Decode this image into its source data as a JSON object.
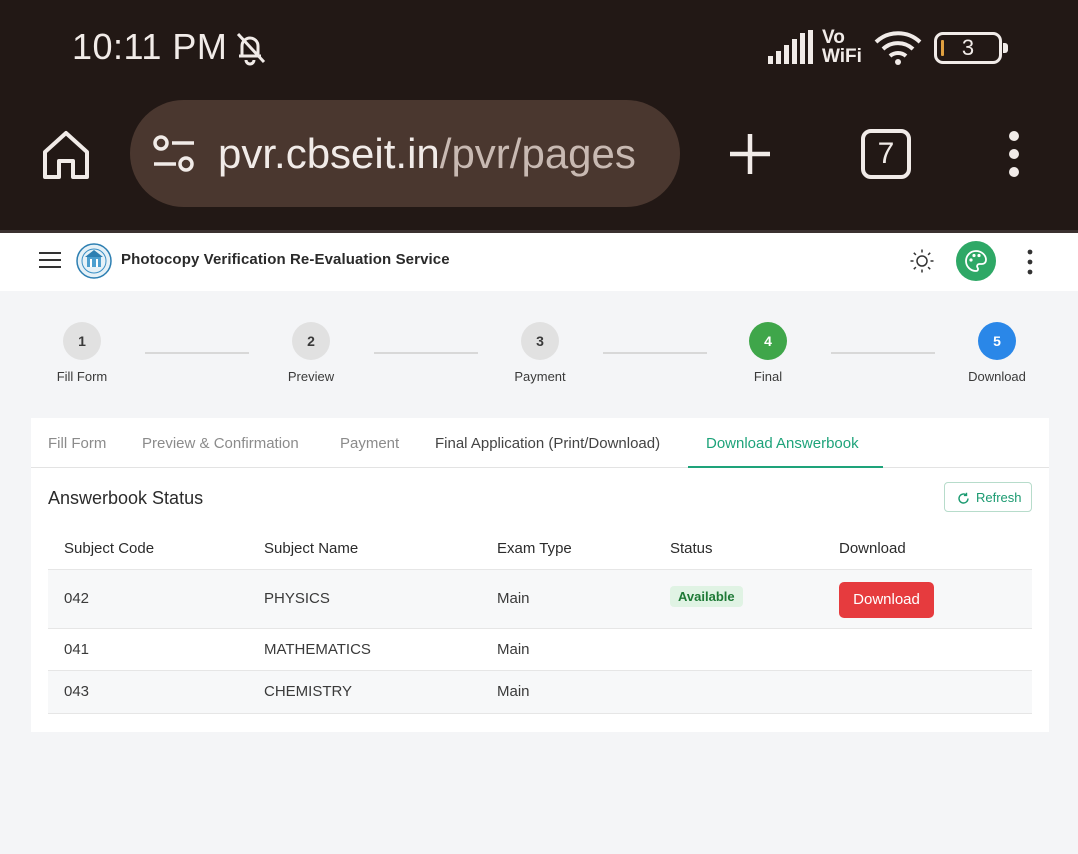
{
  "status_bar": {
    "time": "10:11 PM",
    "network": "Vo\nWiFi",
    "vo": "Vo",
    "wifi": "WiFi",
    "battery": "3"
  },
  "browser": {
    "url_host": "pvr.cbseit.in",
    "url_path": "/pvr/pages",
    "tab_count": "7"
  },
  "app": {
    "title": "Photocopy Verification Re-Evaluation Service",
    "accent": "#1ea37a"
  },
  "stepper": [
    {
      "number": "1",
      "label": "Fill Form",
      "state": "pending"
    },
    {
      "number": "2",
      "label": "Preview",
      "state": "pending"
    },
    {
      "number": "3",
      "label": "Payment",
      "state": "pending"
    },
    {
      "number": "4",
      "label": "Final",
      "state": "done"
    },
    {
      "number": "5",
      "label": "Download",
      "state": "current"
    }
  ],
  "tabs": [
    {
      "label": "Fill Form"
    },
    {
      "label": "Preview & Confirmation"
    },
    {
      "label": "Payment"
    },
    {
      "label": "Final Application (Print/Download)"
    },
    {
      "label": "Download Answerbook",
      "active": true
    }
  ],
  "section": {
    "title": "Answerbook Status",
    "refresh_label": "Refresh"
  },
  "table": {
    "headers": [
      "Subject Code",
      "Subject Name",
      "Exam Type",
      "Status",
      "Download"
    ],
    "rows": [
      {
        "code": "042",
        "name": "PHYSICS",
        "exam_type": "Main",
        "status": "Available",
        "download": "Download"
      },
      {
        "code": "041",
        "name": "MATHEMATICS",
        "exam_type": "Main",
        "status": "",
        "download": ""
      },
      {
        "code": "043",
        "name": "CHEMISTRY",
        "exam_type": "Main",
        "status": "",
        "download": ""
      }
    ]
  }
}
